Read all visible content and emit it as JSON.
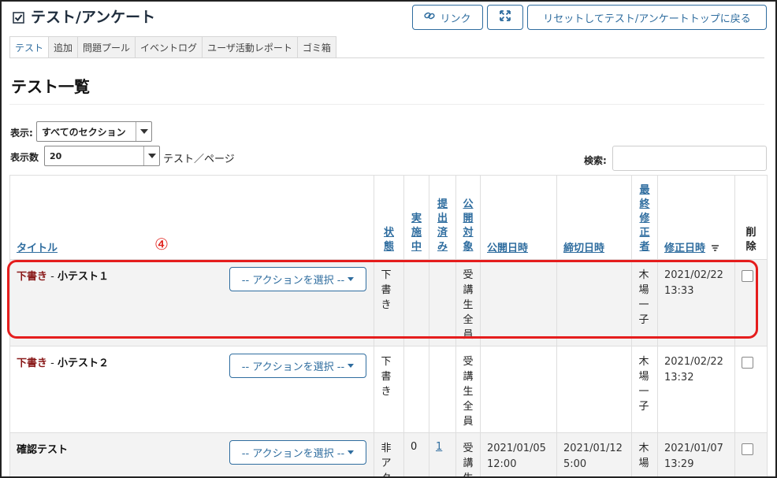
{
  "header": {
    "title": "テスト/アンケート",
    "link_label": "リンク",
    "reset_label": "リセットしてテスト/アンケートトップに戻る"
  },
  "tabs": [
    "テスト",
    "追加",
    "問題プール",
    "イベントログ",
    "ユーザ活動レポート",
    "ゴミ箱"
  ],
  "page_title": "テスト一覧",
  "filters": {
    "display_label": "表示:",
    "display_value": "すべてのセクション",
    "count_label": "表示数",
    "count_value": "20",
    "count_suffix": "テスト／ページ",
    "search_label": "検索:"
  },
  "columns": {
    "title": "タイトル",
    "status": "状態",
    "active": "実施中",
    "submitted": "提出済み",
    "audience": "公開対象",
    "open_date": "公開日時",
    "due_date": "締切日時",
    "modifier": "最終修正者",
    "modified_date": "修正日時",
    "delete": "削除"
  },
  "action_label": "-- アクションを選択 --",
  "marker": "④",
  "rows": [
    {
      "draft": "下書き",
      "sep": " - ",
      "name": "小テスト１",
      "status": "下書き",
      "active": "",
      "submitted": "",
      "audience": "受講生全員",
      "open": "",
      "due": "",
      "modifier": "木場一子",
      "modified": "2021/02/22 13:33"
    },
    {
      "draft": "下書き",
      "sep": " - ",
      "name": "小テスト２",
      "status": "下書き",
      "active": "",
      "submitted": "",
      "audience": "受講生全員",
      "open": "",
      "due": "",
      "modifier": "木場一子",
      "modified": "2021/02/22 13:32"
    },
    {
      "draft": "",
      "sep": "",
      "name": "確認テスト",
      "status": "非アク",
      "active": "0",
      "submitted": "1",
      "audience": "受講生",
      "open": "2021/01/05 12:00",
      "due": "2021/01/12 5:00",
      "modifier": "木場一",
      "modified": "2021/01/07 13:29"
    }
  ]
}
